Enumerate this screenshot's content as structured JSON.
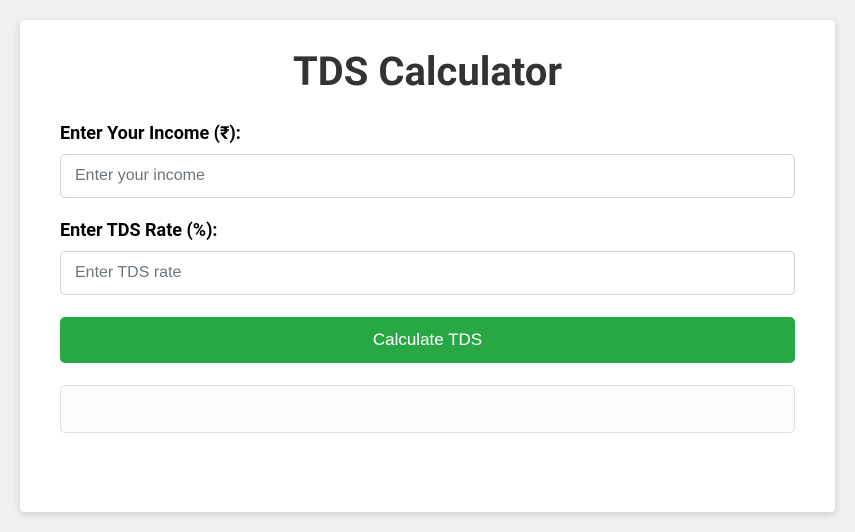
{
  "title": "TDS Calculator",
  "form": {
    "income": {
      "label": "Enter Your Income (₹):",
      "placeholder": "Enter your income",
      "value": ""
    },
    "rate": {
      "label": "Enter TDS Rate (%):",
      "placeholder": "Enter TDS rate",
      "value": ""
    },
    "button_label": "Calculate TDS"
  },
  "result": ""
}
